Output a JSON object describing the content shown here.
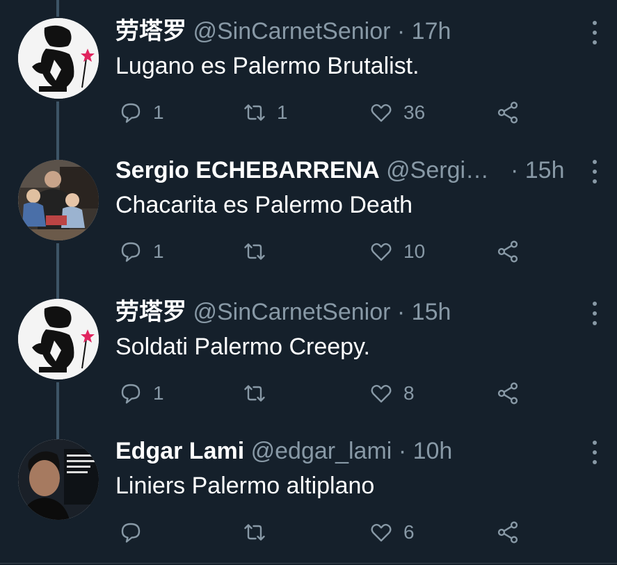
{
  "tweets": [
    {
      "name": "劳塔罗",
      "handle": "@SinCarnetSenior",
      "time": "· 17h",
      "text": "Lugano es Palermo Brutalist.",
      "reply_count": "1",
      "retweet_count": "1",
      "like_count": "36",
      "avatar": "stencil-figure-avatar"
    },
    {
      "name": "Sergio ECHEBARRENA",
      "handle": "@Sergi…",
      "time": "· 15h",
      "text": "Chacarita es Palermo Death",
      "reply_count": "1",
      "retweet_count": "",
      "like_count": "10",
      "avatar": "family-photo-avatar"
    },
    {
      "name": "劳塔罗",
      "handle": "@SinCarnetSenior",
      "time": "· 15h",
      "text": "Soldati Palermo Creepy.",
      "reply_count": "1",
      "retweet_count": "",
      "like_count": "8",
      "avatar": "stencil-figure-avatar"
    },
    {
      "name": "Edgar Lami",
      "handle": "@edgar_lami",
      "time": "· 10h",
      "text": "Liniers Palermo altiplano",
      "reply_count": "",
      "retweet_count": "",
      "like_count": "6",
      "avatar": "portrait-avatar"
    }
  ],
  "colors": {
    "background": "#15202b",
    "secondary_text": "#8899a6",
    "thread_line": "#3d5466",
    "star": "#e0245e"
  }
}
